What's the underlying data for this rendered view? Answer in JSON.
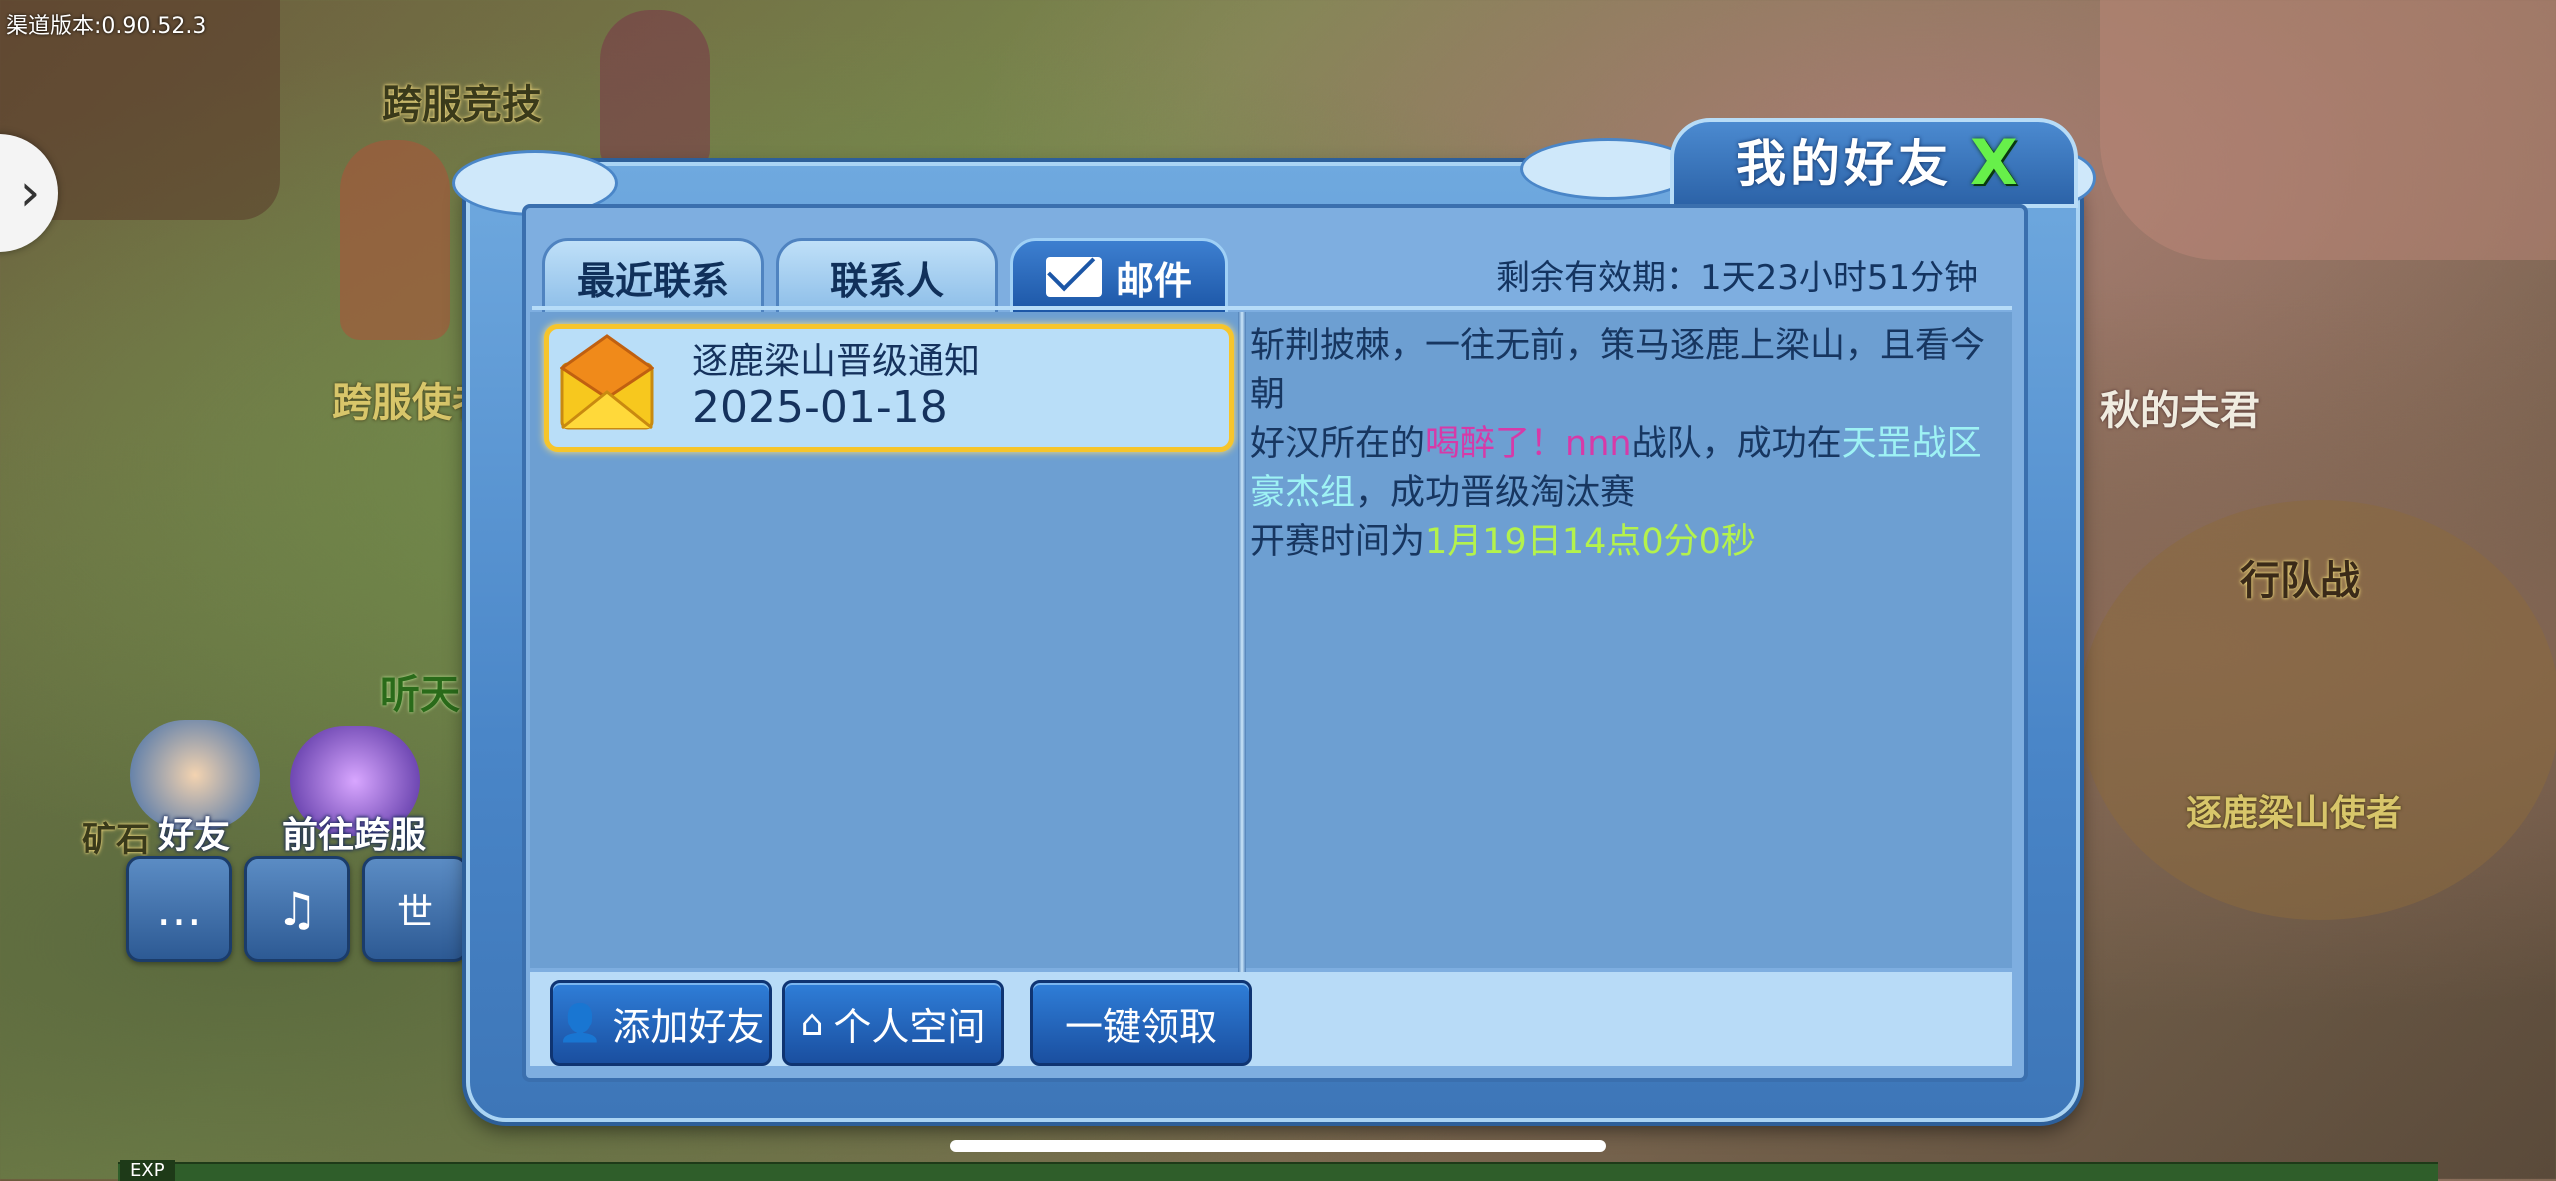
{
  "hud": {
    "version_text": "渠道版本:0.90.52.3",
    "map_labels": {
      "cross_server_arena": "跨服竞技",
      "cross_server_envoy": "跨服使者",
      "listen": "听天",
      "mine": "矿石",
      "autumn_husband": "秋的夫君",
      "team_battle": "行队战",
      "zhulu_envoy": "逐鹿梁山使者"
    },
    "friends_label": "好友",
    "cross_server_label": "前往跨服",
    "exp_label": "EXP"
  },
  "dialog": {
    "title": "我的好友",
    "close_label": "X",
    "tabs": [
      {
        "label": "最近联系",
        "active": false
      },
      {
        "label": "联系人",
        "active": false
      },
      {
        "label": "邮件",
        "active": true
      }
    ],
    "validity": "剩余有效期：1天23小时51分钟",
    "mail_list": [
      {
        "subject": "逐鹿梁山晋级通知",
        "date": "2025-01-18",
        "selected": true
      }
    ],
    "mail_body": {
      "line1": "斩荆披棘，一往无前，策马逐鹿上梁山，且看今朝",
      "line2_pre": "好汉所在的",
      "team_name": "喝醉了！nnn",
      "line2_mid": "战队，成功在",
      "zone_name": "天罡战区豪杰组",
      "line2_post": "，成功晋级淘汰赛",
      "line3_pre": "开赛时间为",
      "start_time": "1月19日14点0分0秒"
    },
    "buttons": {
      "add_friend": "添加好友",
      "personal_space": "个人空间",
      "claim_all": "一键领取"
    }
  },
  "colors": {
    "panel_blue": "#6d9fd2",
    "highlight_pink": "#d63aa8",
    "highlight_cyan": "#9ef2f4",
    "highlight_green": "#b4f24c",
    "selected_border": "#f6c52b"
  }
}
